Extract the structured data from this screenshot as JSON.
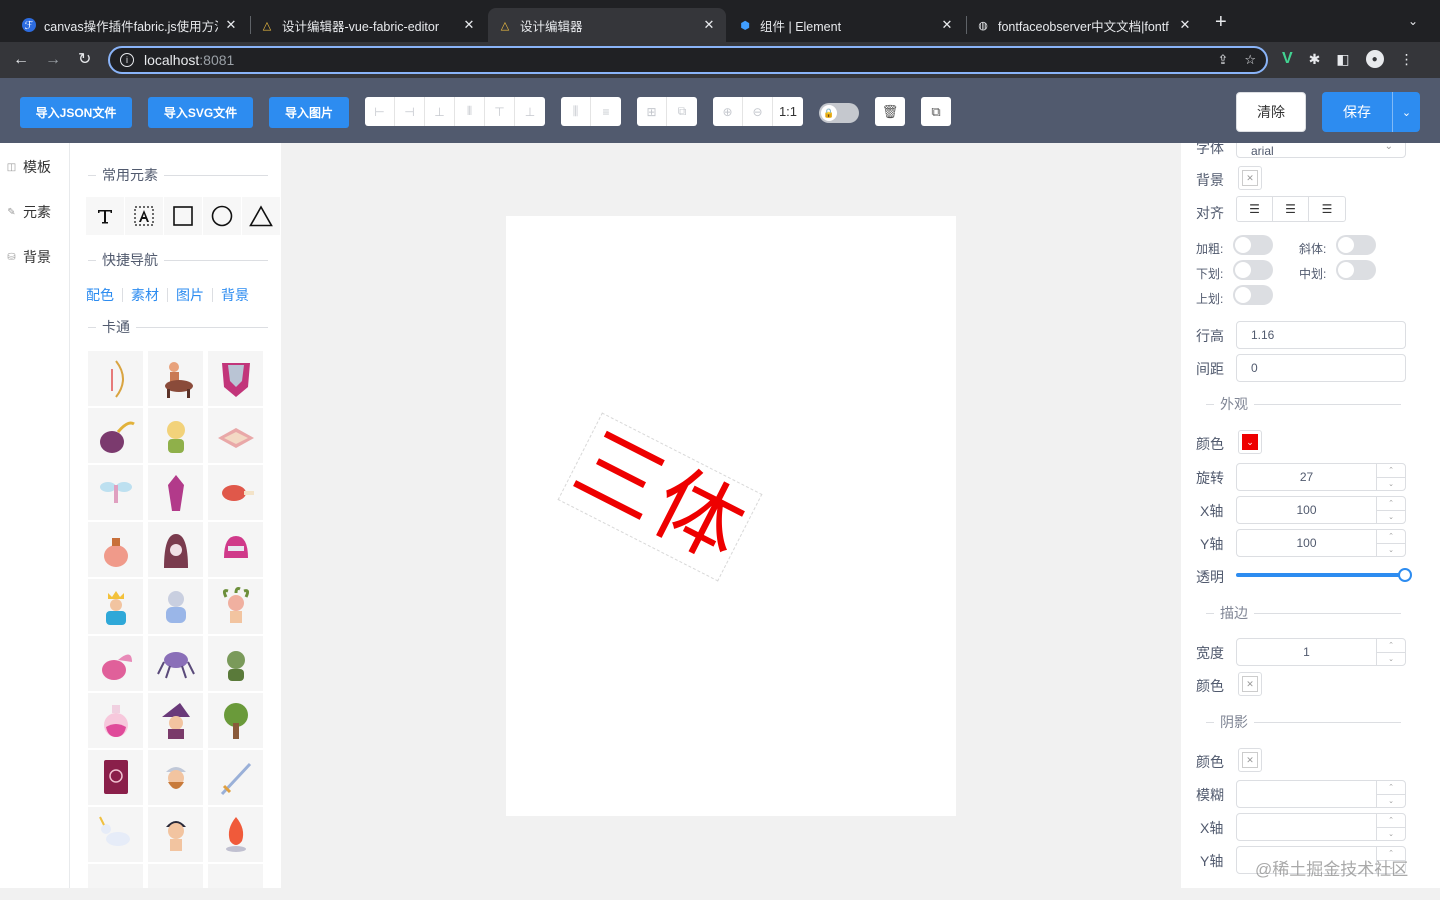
{
  "browser": {
    "tabs": [
      {
        "title": "canvas操作插件fabric.js使用方法",
        "icon": "ℱ"
      },
      {
        "title": "设计编辑器-vue-fabric-editor",
        "icon": "△"
      },
      {
        "title": "设计编辑器",
        "icon": "△"
      },
      {
        "title": "组件 | Element",
        "icon": "⬢"
      },
      {
        "title": "fontfaceobserver中文文档|fontf",
        "icon": "◍"
      }
    ],
    "close_glyph": "✕",
    "new_tab_glyph": "+",
    "url_host": "localhost",
    "url_port": ":8081"
  },
  "toolbar": {
    "import_json": "导入JSON文件",
    "import_svg": "导入SVG文件",
    "import_image": "导入图片",
    "zoom_reset": "1:1",
    "clear": "清除",
    "save": "保存"
  },
  "leftnav": {
    "items": [
      {
        "label": "模板",
        "icon": "◫"
      },
      {
        "label": "元素",
        "icon": "✎"
      },
      {
        "label": "背景",
        "icon": "⛁"
      }
    ]
  },
  "leftpanel": {
    "common_title": "常用元素",
    "quicknav_title": "快捷导航",
    "quicknav": [
      "配色",
      "素材",
      "图片",
      "背景"
    ],
    "cartoon_title": "卡通"
  },
  "canvas": {
    "text": "三体",
    "text_color": "#ee0000"
  },
  "properties": {
    "font_label": "字体",
    "font_value": "arial",
    "background_label": "背景",
    "align_label": "对齐",
    "bold_label": "加粗:",
    "italic_label": "斜体:",
    "underline_label": "下划:",
    "linethrough_label": "中划:",
    "overline_label": "上划:",
    "line_height_label": "行高",
    "line_height_value": "1.16",
    "spacing_label": "间距",
    "spacing_value": "0",
    "appearance_title": "外观",
    "color_label": "颜色",
    "rotate_label": "旋转",
    "rotate_value": "27",
    "x_label": "X轴",
    "x_value": "100",
    "y_label": "Y轴",
    "y_value": "100",
    "opacity_label": "透明",
    "opacity_value": 1,
    "stroke_title": "描边",
    "stroke_width_label": "宽度",
    "stroke_width_value": "1",
    "stroke_color_label": "颜色",
    "shadow_title": "阴影",
    "shadow_color_label": "颜色",
    "shadow_blur_label": "模糊",
    "shadow_x_label": "X轴",
    "shadow_y_label": "Y轴"
  },
  "watermark": "@稀土掘金技术社区",
  "colors": {
    "primary": "#2d8cf0",
    "header": "#515a6e",
    "accent_red": "#ee0000"
  }
}
